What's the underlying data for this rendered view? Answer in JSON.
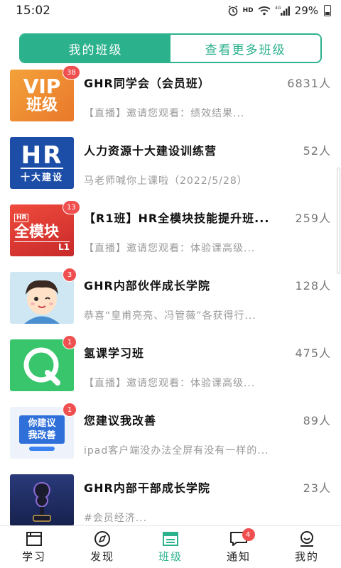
{
  "status_bar": {
    "time": "15:02",
    "hd": "HD",
    "network": "4G",
    "battery": "29%"
  },
  "tabs": {
    "my_classes": "我的班级",
    "more_classes": "查看更多班级"
  },
  "classes": [
    {
      "title": "GHR同学会（会员班）",
      "count": "6831人",
      "subtitle": "【直播】邀请您观看：绩效结果...",
      "badge": "38",
      "thumb_text": [
        "VIP",
        "班级"
      ]
    },
    {
      "title": "人力资源十大建设训练营",
      "count": "52人",
      "subtitle": "马老师喊你上课啦（2022/5/28）",
      "badge": "",
      "thumb_text": [
        "HR",
        "十大建设"
      ]
    },
    {
      "title": "【R1班】HR全模块技能提升班...",
      "count": "259人",
      "subtitle": "【直播】邀请您观看：体验课高级...",
      "badge": "13",
      "thumb_text": [
        "HR",
        "全模块",
        "L1"
      ]
    },
    {
      "title": "GHR内部伙伴成长学院",
      "count": "128人",
      "subtitle": "恭喜“皇甫亮亮、冯管薇”各获得行...",
      "badge": "3",
      "thumb_text": []
    },
    {
      "title": "氢课学习班",
      "count": "475人",
      "subtitle": "【直播】邀请您观看：体验课高级...",
      "badge": "1",
      "thumb_text": []
    },
    {
      "title": "您建议我改善",
      "count": "89人",
      "subtitle": "ipad客户端没办法全屏有没有一样的...",
      "badge": "1",
      "thumb_text": [
        "你建议",
        "我改善"
      ]
    },
    {
      "title": "GHR内部干部成长学院",
      "count": "23人",
      "subtitle": "#会员经济...",
      "badge": "",
      "thumb_text": []
    }
  ],
  "bottom_nav": {
    "items": [
      {
        "label": "学习",
        "icon": "book-icon"
      },
      {
        "label": "发现",
        "icon": "compass-icon"
      },
      {
        "label": "班级",
        "icon": "class-icon"
      },
      {
        "label": "通知",
        "icon": "message-icon",
        "badge": "4"
      },
      {
        "label": "我的",
        "icon": "user-icon"
      }
    ]
  },
  "colors": {
    "accent": "#2bb18c",
    "badge": "#f04f4f"
  }
}
